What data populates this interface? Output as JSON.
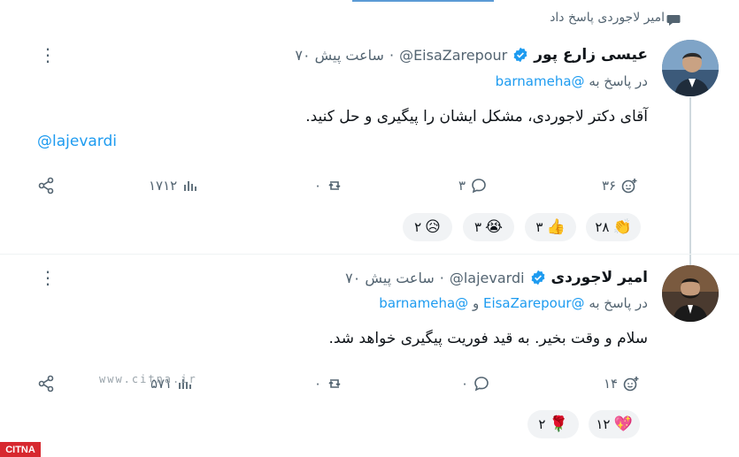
{
  "context": {
    "text": "امیر لاجوردی پاسخ داد",
    "icon": "speech-bubble-icon"
  },
  "tweets": [
    {
      "name": "عیسی زارع پور",
      "handle": "@EisaZarepour",
      "time": "۷۰ ساعت پیش",
      "replying_prefix": "در پاسخ به",
      "replying_to": "@barnameha",
      "replying_conj": "",
      "replying_to_2": "",
      "body": "آقای دکتر لاجوردی، مشکل ایشان را پیگیری و حل کنید.",
      "mention_line": "@lajevardi",
      "actions": {
        "reactions": "۳۶",
        "comments": "۳",
        "retweets": "۰",
        "views": "۱۷۱۲"
      },
      "emoji_reactions": [
        {
          "emoji": "👏",
          "count": "۲۸"
        },
        {
          "emoji": "👍",
          "count": "۳"
        },
        {
          "emoji": "😭",
          "count": "۳"
        },
        {
          "emoji": "😥",
          "count": "۲"
        }
      ]
    },
    {
      "name": "امیر لاجوردی",
      "handle": "@lajevardi",
      "time": "۷۰ ساعت پیش",
      "replying_prefix": "در پاسخ به",
      "replying_to": "@EisaZarepour",
      "replying_conj": "و",
      "replying_to_2": "@barnameha",
      "body": "سلام و وقت بخیر. به قید فوریت پیگیری خواهد شد.",
      "mention_line": "",
      "actions": {
        "reactions": "۱۴",
        "comments": "۰",
        "retweets": "۰",
        "views": "۵۷۱"
      },
      "emoji_reactions": [
        {
          "emoji": "💖",
          "count": "۱۲"
        },
        {
          "emoji": "🌹",
          "count": "۲"
        }
      ]
    }
  ],
  "watermark": "www.citna.ir",
  "logo": "CITNA",
  "colors": {
    "accent": "#1d9bf0",
    "verified": "#1d9bf0",
    "muted": "#536471"
  }
}
